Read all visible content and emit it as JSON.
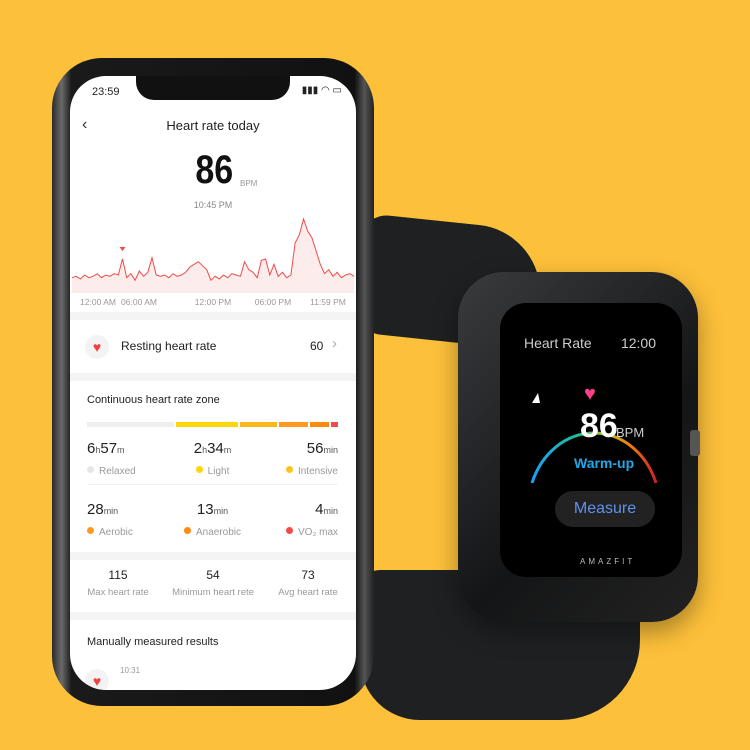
{
  "phone": {
    "status_time": "23:59",
    "header": {
      "title": "Heart rate today",
      "back_icon": "chevron-left-icon"
    },
    "current": {
      "value": "86",
      "unit": "BPM",
      "time": "10:45 PM"
    },
    "chart_data": {
      "type": "area",
      "x_ticks": [
        "12:00 AM",
        "06:00 AM",
        "12:00 PM",
        "06:00 PM",
        "11:59 PM"
      ],
      "values": [
        60,
        61,
        59,
        62,
        60,
        61,
        63,
        60,
        62,
        61,
        63,
        62,
        74,
        60,
        63,
        58,
        65,
        61,
        64,
        75,
        62,
        61,
        62,
        60,
        63,
        61,
        62,
        64,
        68,
        70,
        72,
        69,
        66,
        58,
        61,
        59,
        62,
        60,
        63,
        62,
        61,
        72,
        66,
        64,
        60,
        73,
        74,
        62,
        70,
        61,
        64,
        60,
        62,
        86,
        92,
        104,
        95,
        90,
        80,
        70,
        63,
        66,
        61,
        64,
        60,
        62,
        63,
        61
      ],
      "marker_index": 12,
      "line_color": "#f04a4a"
    },
    "resting": {
      "label": "Resting heart rate",
      "value": "60",
      "icon": "heart-icon"
    },
    "zone": {
      "title": "Continuous heart rate zone",
      "bar": [
        {
          "fraction": 0.36,
          "color": "#eeeeee"
        },
        {
          "fraction": 0.26,
          "color": "#ffd60a"
        },
        {
          "fraction": 0.15,
          "color": "#ffb81a"
        },
        {
          "fraction": 0.12,
          "color": "#ff9a1f"
        },
        {
          "fraction": 0.08,
          "color": "#ff8a10"
        },
        {
          "fraction": 0.03,
          "color": "#f24a4a"
        }
      ],
      "items": [
        {
          "v1": "6",
          "u1": "h",
          "v2": "57",
          "u2": "m",
          "label": "Relaxed",
          "color": "#e6e6e6"
        },
        {
          "v1": "2",
          "u1": "h",
          "v2": "34",
          "u2": "m",
          "label": "Light",
          "color": "#ffd60a"
        },
        {
          "v1": "56",
          "u1": "min",
          "v2": "",
          "u2": "",
          "label": "Intensive",
          "color": "#ffc21a"
        },
        {
          "v1": "28",
          "u1": "min",
          "v2": "",
          "u2": "",
          "label": "Aerobic",
          "color": "#ff9a1f"
        },
        {
          "v1": "13",
          "u1": "min",
          "v2": "",
          "u2": "",
          "label": "Anaerobic",
          "color": "#ff8a10"
        },
        {
          "v1": "4",
          "u1": "min",
          "v2": "",
          "u2": "",
          "label": "VO₂ max",
          "color": "#f24a4a"
        }
      ]
    },
    "stats": [
      {
        "value": "115",
        "label": "Max heart rate"
      },
      {
        "value": "54",
        "label": "Minimum heart rete"
      },
      {
        "value": "73",
        "label": "Avg heart rate"
      }
    ],
    "manual": {
      "title": "Manually measured results",
      "item_time": "10:31"
    }
  },
  "watch": {
    "title": "Heart Rate",
    "time": "12:00",
    "bpm": "86",
    "unit": "BPM",
    "zone": "Warm-up",
    "button": "Measure",
    "brand": "AMAZFIT"
  }
}
